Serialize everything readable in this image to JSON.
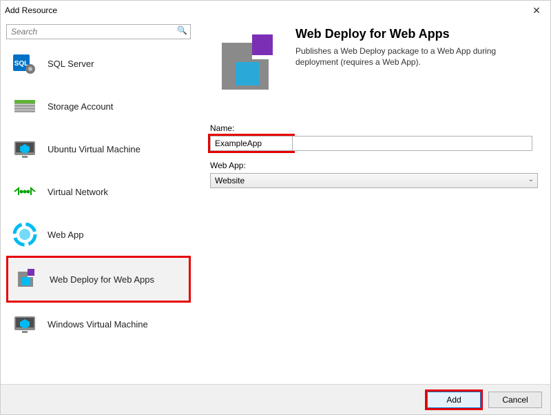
{
  "window": {
    "title": "Add Resource",
    "close_glyph": "✕"
  },
  "search": {
    "placeholder": "Search",
    "mag_glyph": "🔍"
  },
  "resources": [
    {
      "id": "sql",
      "label": "SQL Server"
    },
    {
      "id": "storage",
      "label": "Storage Account"
    },
    {
      "id": "ubuntu",
      "label": "Ubuntu Virtual Machine"
    },
    {
      "id": "vnet",
      "label": "Virtual Network"
    },
    {
      "id": "webapp",
      "label": "Web App"
    },
    {
      "id": "webdeploy",
      "label": "Web Deploy for Web Apps"
    },
    {
      "id": "winvm",
      "label": "Windows Virtual Machine"
    }
  ],
  "detail": {
    "title": "Web Deploy for Web Apps",
    "description": "Publishes a Web Deploy package to a Web App during deployment (requires a Web App)."
  },
  "form": {
    "name_label": "Name:",
    "name_value": "ExampleApp",
    "webapp_label": "Web App:",
    "webapp_value": "Website"
  },
  "footer": {
    "add": "Add",
    "cancel": "Cancel"
  }
}
